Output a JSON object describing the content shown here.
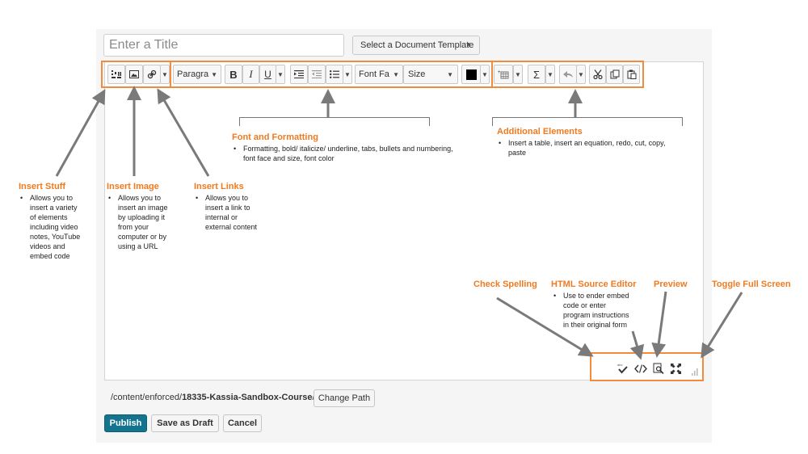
{
  "editor": {
    "title_placeholder": "Enter a Title",
    "template_label": "Select a Document Template",
    "toolbar": {
      "paragraph": "Paragra",
      "bold": "B",
      "italic": "I",
      "underline": "U",
      "font_face": "Font Fa",
      "size": "Size",
      "equation": "Σ",
      "font_color": "#000000"
    }
  },
  "annotations": {
    "insert_stuff": {
      "title": "Insert Stuff",
      "lines": [
        "Allows you to",
        "insert a variety",
        "of elements",
        "including video",
        "notes, YouTube",
        "videos and",
        "embed code"
      ]
    },
    "insert_image": {
      "title": "Insert Image",
      "lines": [
        "Allows you to",
        "insert an image",
        "by uploading it",
        "from your",
        "computer or by",
        "using a URL"
      ]
    },
    "insert_links": {
      "title": "Insert Links",
      "lines": [
        "Allows you to",
        "insert a link to",
        "internal or",
        "external content"
      ]
    },
    "font_formatting": {
      "title": "Font and Formatting",
      "lines": [
        "Formatting, bold/ italicize/ underline, tabs, bullets and numbering,",
        "font face and size, font color"
      ]
    },
    "additional_elements": {
      "title": "Additional Elements",
      "lines": [
        "Insert a table, insert an equation, redo, cut, copy,",
        "paste"
      ]
    },
    "check_spelling": {
      "title": "Check Spelling"
    },
    "html_source": {
      "title": "HTML Source Editor",
      "lines": [
        "Use to ender embed",
        "code or enter",
        "program instructions",
        "in their original form"
      ]
    },
    "preview": {
      "title": "Preview"
    },
    "toggle_full": {
      "title": "Toggle Full Screen"
    }
  },
  "footer": {
    "path_prefix": "/content/enforced/",
    "path_bold": "18335-Kassia-Sandbox-Course",
    "path_suffix": "/",
    "change_path": "Change Path",
    "publish": "Publish",
    "save_draft": "Save as Draft",
    "cancel": "Cancel"
  },
  "colors": {
    "accent": "#f28c3c",
    "annotation_text": "#f07a1f",
    "primary_button": "#14738d"
  }
}
